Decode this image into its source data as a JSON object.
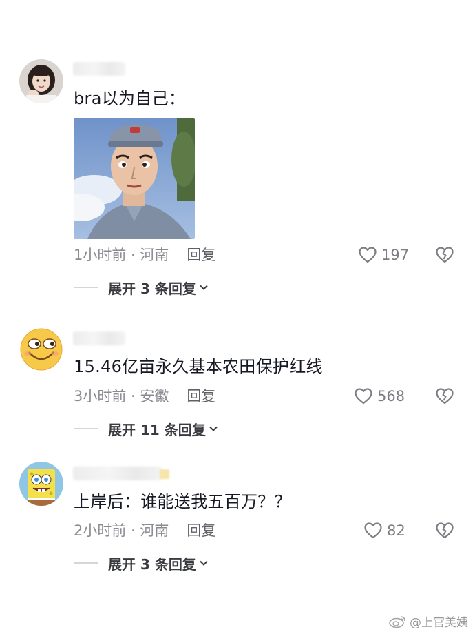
{
  "comments": [
    {
      "text": "bra以为自己：",
      "time": "1小时前",
      "location": "河南",
      "reply_label": "回复",
      "likes": "197",
      "expand_label": "展开 3 条回复"
    },
    {
      "text": "15.46亿亩永久基本农田保护红线",
      "time": "3小时前",
      "location": "安徽",
      "reply_label": "回复",
      "likes": "568",
      "expand_label": "展开 11 条回复"
    },
    {
      "text": "上岸后：谁能送我五百万？？",
      "time": "2小时前",
      "location": "河南",
      "reply_label": "回复",
      "likes": "82",
      "expand_label": "展开 3 条回复"
    }
  ],
  "watermark": "@上官美姨",
  "colors": {
    "text": "#161823",
    "meta": "#8a8b91",
    "icon": "#7c7d83"
  },
  "icons": {
    "like": "heart-outline-icon",
    "dislike": "broken-heart-icon",
    "expand": "chevron-down-icon"
  }
}
